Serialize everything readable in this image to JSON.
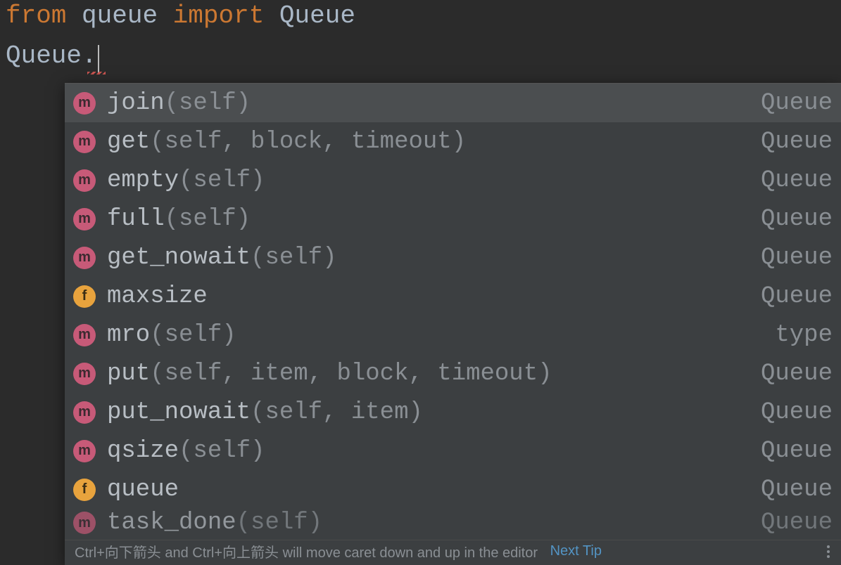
{
  "code": {
    "line1": {
      "kw1": "from",
      "mod": "queue",
      "kw2": "import",
      "cls": "Queue"
    },
    "line2": {
      "text": "Queue."
    }
  },
  "squiggle_text": "~~~",
  "suggestions": [
    {
      "icon": "m",
      "name": "join",
      "params": "(self)",
      "origin": "Queue",
      "selected": true
    },
    {
      "icon": "m",
      "name": "get",
      "params": "(self, block, timeout)",
      "origin": "Queue",
      "selected": false
    },
    {
      "icon": "m",
      "name": "empty",
      "params": "(self)",
      "origin": "Queue",
      "selected": false
    },
    {
      "icon": "m",
      "name": "full",
      "params": "(self)",
      "origin": "Queue",
      "selected": false
    },
    {
      "icon": "m",
      "name": "get_nowait",
      "params": "(self)",
      "origin": "Queue",
      "selected": false
    },
    {
      "icon": "f",
      "name": "maxsize",
      "params": "",
      "origin": "Queue",
      "selected": false
    },
    {
      "icon": "m",
      "name": "mro",
      "params": "(self)",
      "origin": "type",
      "selected": false
    },
    {
      "icon": "m",
      "name": "put",
      "params": "(self, item, block, timeout)",
      "origin": "Queue",
      "selected": false
    },
    {
      "icon": "m",
      "name": "put_nowait",
      "params": "(self, item)",
      "origin": "Queue",
      "selected": false
    },
    {
      "icon": "m",
      "name": "qsize",
      "params": "(self)",
      "origin": "Queue",
      "selected": false
    },
    {
      "icon": "f",
      "name": "queue",
      "params": "",
      "origin": "Queue",
      "selected": false
    },
    {
      "icon": "m",
      "name": "task_done",
      "params": "(self)",
      "origin": "Queue",
      "selected": false,
      "partial": true
    }
  ],
  "footer": {
    "hint": "Ctrl+向下箭头 and Ctrl+向上箭头 will move caret down and up in the editor",
    "link": "Next Tip"
  }
}
